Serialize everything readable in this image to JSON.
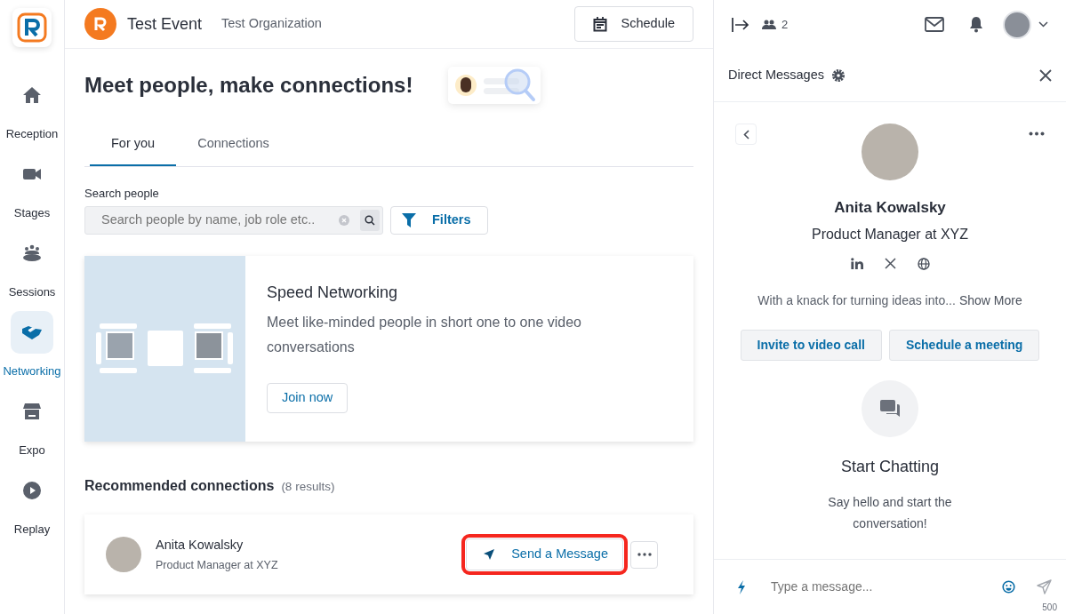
{
  "sidebar": {
    "items": [
      {
        "label": "Reception",
        "selected": false
      },
      {
        "label": "Stages",
        "selected": false
      },
      {
        "label": "Sessions",
        "selected": false
      },
      {
        "label": "Networking",
        "selected": true
      },
      {
        "label": "Expo",
        "selected": false
      },
      {
        "label": "Replay",
        "selected": false
      }
    ]
  },
  "header": {
    "event_title": "Test Event",
    "organization": "Test Organization",
    "schedule_button": "Schedule"
  },
  "page": {
    "heading": "Meet people, make connections!",
    "tabs": [
      {
        "label": "For you",
        "selected": true
      },
      {
        "label": "Connections",
        "selected": false
      }
    ],
    "search": {
      "label": "Search people",
      "placeholder": "Search people by name, job role etc..",
      "filters_button": "Filters"
    },
    "speed_networking": {
      "title": "Speed Networking",
      "description": "Meet like-minded people in short one to one video conversations",
      "button": "Join now"
    },
    "recommended": {
      "title": "Recommended connections",
      "count": "(8 results)",
      "people": [
        {
          "name": "Anita Kowalsky",
          "role": "Product Manager at XYZ",
          "action": "Send a Message",
          "highlighted": true
        }
      ]
    }
  },
  "right_panel": {
    "attendee_count": "2",
    "title": "Direct Messages",
    "profile": {
      "name": "Anita Kowalsky",
      "role": "Product Manager at XYZ",
      "bio": "With a knack for turning ideas into...",
      "show_more": "Show More",
      "buttons": [
        "Invite to video call",
        "Schedule a meeting"
      ]
    },
    "empty_state": {
      "title": "Start Chatting",
      "text": "Say hello and start the conversation!"
    },
    "composer": {
      "placeholder": "Type a message...",
      "char_limit": "500"
    }
  }
}
